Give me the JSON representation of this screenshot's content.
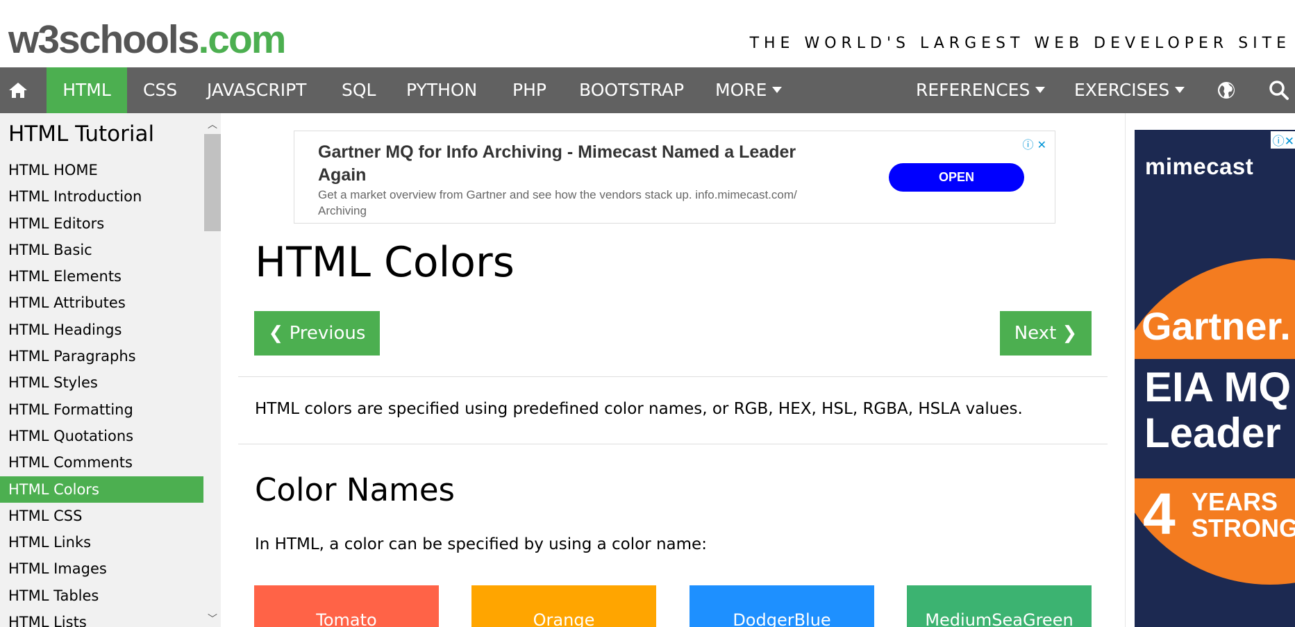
{
  "header": {
    "logo_main": "w3schools",
    "logo_suffix": ".com",
    "tagline": "THE WORLD'S LARGEST WEB DEVELOPER SITE"
  },
  "nav": {
    "items": [
      "HTML",
      "CSS",
      "JAVASCRIPT",
      "SQL",
      "PYTHON",
      "PHP",
      "BOOTSTRAP",
      "MORE"
    ],
    "right": [
      "REFERENCES",
      "EXERCISES"
    ],
    "active": "HTML"
  },
  "sidebar": {
    "title": "HTML Tutorial",
    "items": [
      "HTML HOME",
      "HTML Introduction",
      "HTML Editors",
      "HTML Basic",
      "HTML Elements",
      "HTML Attributes",
      "HTML Headings",
      "HTML Paragraphs",
      "HTML Styles",
      "HTML Formatting",
      "HTML Quotations",
      "HTML Comments",
      "HTML Colors",
      "HTML CSS",
      "HTML Links",
      "HTML Images",
      "HTML Tables",
      "HTML Lists"
    ],
    "active": "HTML Colors"
  },
  "ad_top": {
    "title": "Gartner MQ for Info Archiving - Mimecast Named a Leader Again",
    "description": "Get a market overview from Gartner and see how the vendors stack up. info.mimecast.com/ Archiving",
    "button": "OPEN",
    "icons": "ⓘ ✕"
  },
  "main": {
    "title": "HTML Colors",
    "prev_label": "❮ Previous",
    "next_label": "Next ❯",
    "intro": "HTML colors are specified using predefined color names, or RGB, HEX, HSL, RGBA, HSLA values.",
    "section_title": "Color Names",
    "section_text": "In HTML, a color can be specified by using a color name:",
    "swatches": [
      {
        "name": "Tomato",
        "color": "#FF6347"
      },
      {
        "name": "Orange",
        "color": "#FFA500"
      },
      {
        "name": "DodgerBlue",
        "color": "#1E90FF"
      },
      {
        "name": "MediumSeaGreen",
        "color": "#3CB371"
      }
    ]
  },
  "ad_right": {
    "brand": "mimecast",
    "icons": "ⓘ✕",
    "line1": "Gartner.",
    "line2": "EIA MQ",
    "line3": "Leader",
    "number": "4",
    "years_line1": "YEARS",
    "years_line2": "STRONG"
  },
  "colors": {
    "accent": "#4CAF50",
    "nav_bg": "#616161",
    "sidebar_bg": "#f1f1f1"
  },
  "icons": {
    "home": "home-icon",
    "globe": "globe-icon",
    "search": "search-icon"
  }
}
